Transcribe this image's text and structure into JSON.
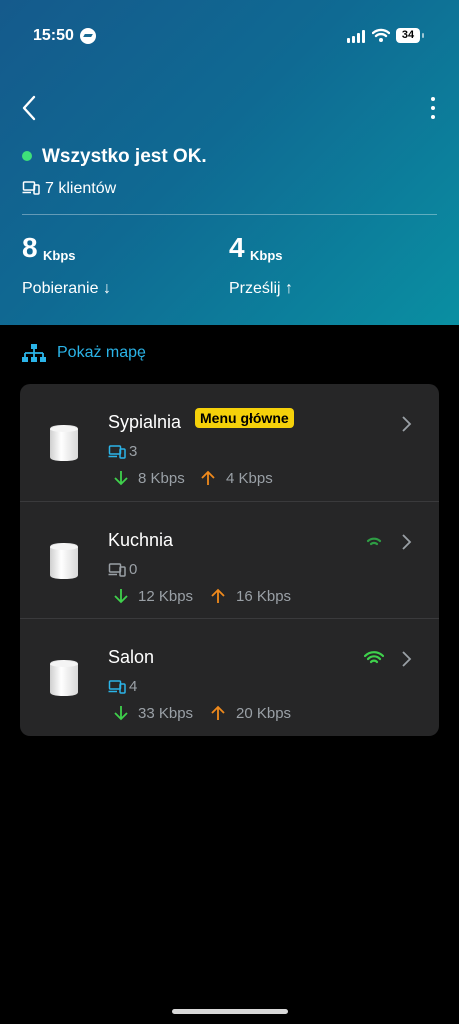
{
  "status_bar": {
    "time": "15:50",
    "battery": "34"
  },
  "header": {
    "status_title": "Wszystko jest OK.",
    "clients": "7 klientów",
    "download": {
      "value": "8",
      "unit": "Kbps",
      "label": "Pobieranie ↓"
    },
    "upload": {
      "value": "4",
      "unit": "Kbps",
      "label": "Prześlij ↑"
    }
  },
  "map_link": "Pokaż mapę",
  "devices": [
    {
      "name": "Sypialnia",
      "badge": "Menu główne",
      "clients": "3",
      "down": "8 Kbps",
      "up": "4 Kbps",
      "wifi_color": ""
    },
    {
      "name": "Kuchnia",
      "clients": "0",
      "down": "12 Kbps",
      "up": "16 Kbps",
      "wifi_color": "#2e9d44"
    },
    {
      "name": "Salon",
      "clients": "4",
      "down": "33 Kbps",
      "up": "20 Kbps",
      "wifi_color": "#3fd14c"
    }
  ],
  "colors": {
    "accent": "#2bb4e8",
    "badge": "#f5d10a",
    "down": "#3fd14c",
    "up": "#f08a1c",
    "ok_dot": "#3ee07a"
  }
}
